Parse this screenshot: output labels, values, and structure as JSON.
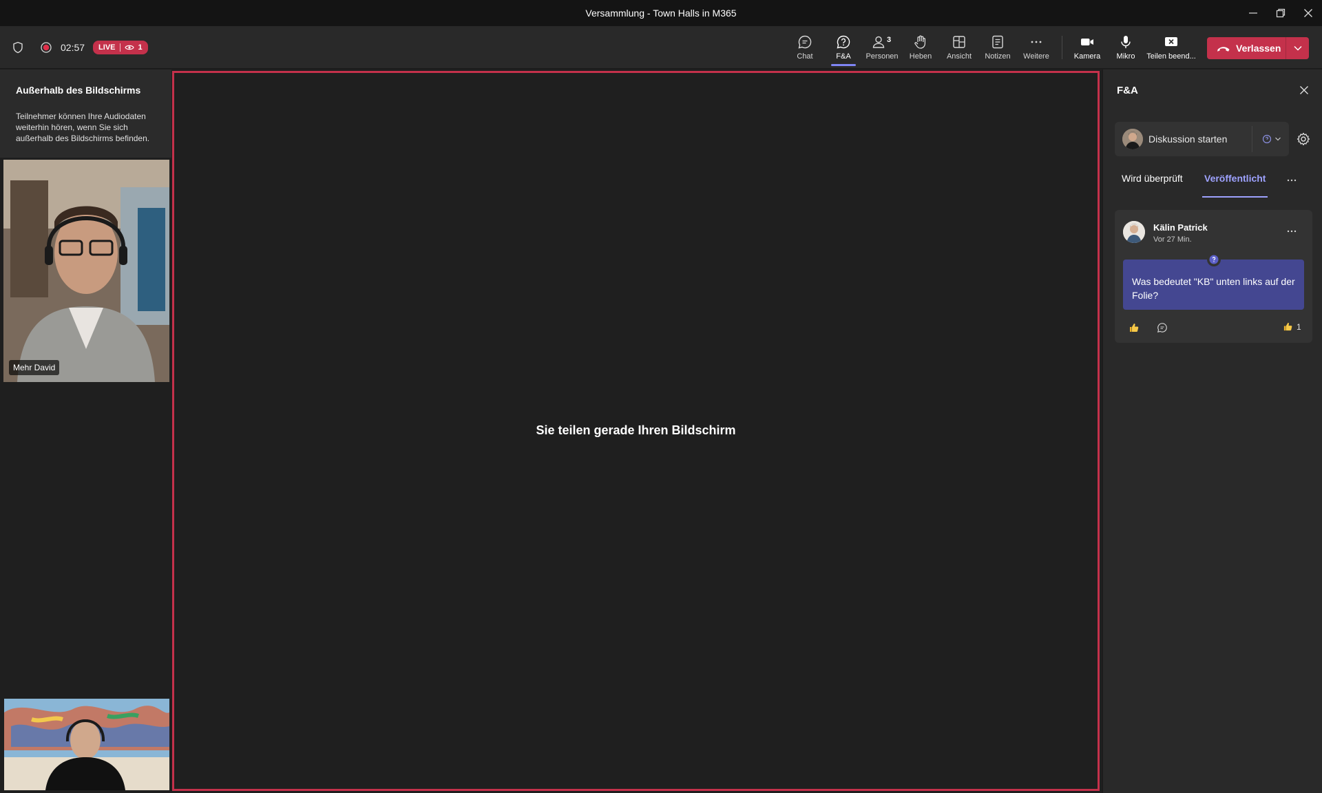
{
  "window": {
    "title": "Versammlung - Town Halls in M365"
  },
  "toolbar": {
    "timer": "02:57",
    "live_label": "LIVE",
    "viewer_count": "1",
    "items": [
      {
        "key": "chat",
        "label": "Chat",
        "icon": "chat-icon"
      },
      {
        "key": "qa",
        "label": "F&A",
        "icon": "qa-icon",
        "active": true
      },
      {
        "key": "people",
        "label": "Personen",
        "icon": "people-icon",
        "badge": "3"
      },
      {
        "key": "raise",
        "label": "Heben",
        "icon": "raise-hand-icon"
      },
      {
        "key": "view",
        "label": "Ansicht",
        "icon": "view-icon"
      },
      {
        "key": "notes",
        "label": "Notizen",
        "icon": "notes-icon"
      },
      {
        "key": "more",
        "label": "Weitere",
        "icon": "more-icon"
      },
      {
        "key": "camera",
        "label": "Kamera",
        "icon": "camera-icon"
      },
      {
        "key": "mic",
        "label": "Mikro",
        "icon": "mic-icon"
      },
      {
        "key": "stop_share",
        "label": "Teilen beend...",
        "icon": "stop-share-icon"
      }
    ],
    "leave_label": "Verlassen",
    "accent_leave": "#c4314b"
  },
  "offscreen": {
    "title": "Außerhalb des Bildschirms",
    "text": "Teilnehmer können Ihre Audiodaten weiterhin hören, wenn Sie sich außerhalb des Bildschirms befinden."
  },
  "participants": [
    {
      "name": "Mehr David"
    }
  ],
  "stage": {
    "message": "Sie teilen gerade Ihren Bildschirm",
    "border_color": "#c4314b"
  },
  "qa_panel": {
    "title": "F&A",
    "compose_placeholder": "Diskussion starten",
    "tabs": [
      {
        "label": "Wird überprüft",
        "active": false
      },
      {
        "label": "Veröffentlicht",
        "active": true
      }
    ],
    "tab_accent": "#9ea2ff",
    "questions": [
      {
        "author": "Kälin Patrick",
        "time": "Vor 27 Min.",
        "text": "Was bedeutet \"KB\" unten links auf der Folie?",
        "likes": "1"
      }
    ]
  }
}
